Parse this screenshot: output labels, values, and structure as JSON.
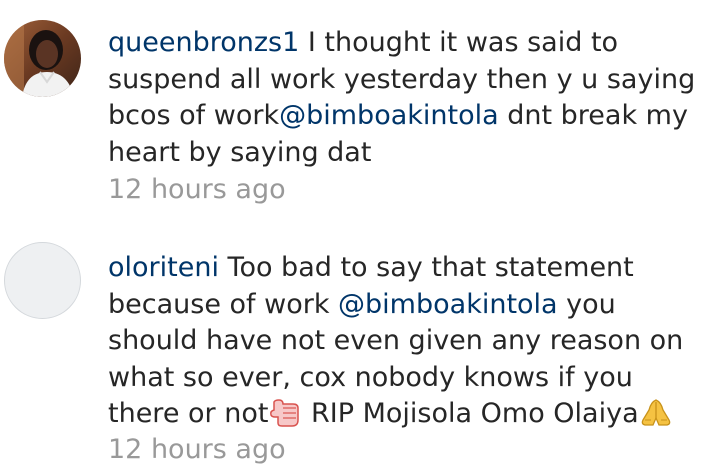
{
  "comments": [
    {
      "username": "queenbronzs1",
      "text_before_mention": " I thought it was said to suspend all work yesterday then y u saying bcos of work",
      "mention": "@bimboakintola",
      "text_after_mention": " dnt break my heart by saying dat",
      "timestamp": "12 hours ago",
      "avatar": "profile-photo"
    },
    {
      "username": "oloriteni",
      "text_before_mention": " Too bad to say that statement because of work ",
      "mention": "@bimboakintola",
      "text_after_mention": " you should have not even given any reason on what so ever, cox nobody knows if you there or not",
      "text_after_emoji": " RIP Mojisola Omo Olaiya",
      "emoji_1": "thumbs-down-hand-emoji",
      "emoji_2": "folded-hands-emoji",
      "timestamp": "12 hours ago",
      "avatar": "default-avatar"
    }
  ],
  "colors": {
    "username": "#003569",
    "text": "#262626",
    "timestamp": "#999999"
  }
}
